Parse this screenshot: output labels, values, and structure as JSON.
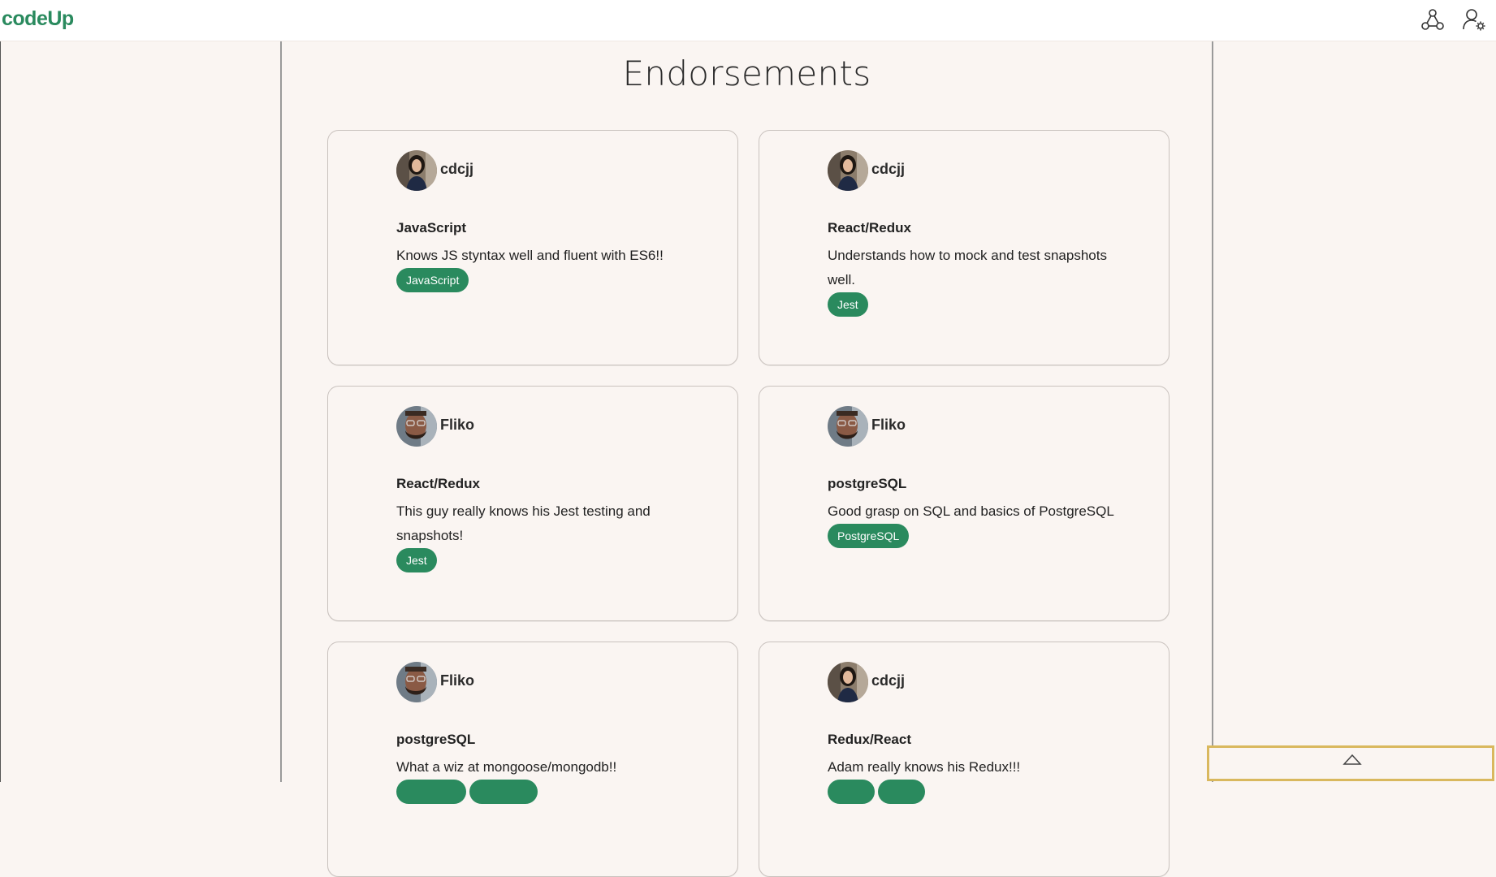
{
  "app": {
    "brand": "codeUp"
  },
  "header": {
    "icons": [
      "network-icon",
      "user-settings-icon"
    ]
  },
  "page": {
    "title": "Endorsements"
  },
  "colors": {
    "brand": "#2a8a5e",
    "tag_bg": "#2a8a5e",
    "background": "#faf5f2",
    "scroll_border": "#d9b85e"
  },
  "endorsements": [
    {
      "user": "cdcjj",
      "avatar": "woman-avatar",
      "skill": "JavaScript",
      "comment": "Knows JS styntax well and fluent with ES6!!",
      "tags": [
        "JavaScript"
      ]
    },
    {
      "user": "cdcjj",
      "avatar": "woman-avatar",
      "skill": "React/Redux",
      "comment": "Understands how to mock and test snapshots well.",
      "tags": [
        "Jest"
      ]
    },
    {
      "user": "Fliko",
      "avatar": "man-avatar",
      "skill": "React/Redux",
      "comment": "This guy really knows his Jest testing and snapshots!",
      "tags": [
        "Jest"
      ]
    },
    {
      "user": "Fliko",
      "avatar": "man-avatar",
      "skill": "postgreSQL",
      "comment": "Good grasp on SQL and basics of PostgreSQL",
      "tags": [
        "PostgreSQL"
      ]
    },
    {
      "user": "Fliko",
      "avatar": "man-avatar",
      "skill": "postgreSQL",
      "comment": "What a wiz at mongoose/mongodb!!",
      "tags": [
        "",
        ""
      ]
    },
    {
      "user": "cdcjj",
      "avatar": "woman-avatar",
      "skill": "Redux/React",
      "comment": "Adam really knows his Redux!!!",
      "tags": [
        "",
        ""
      ]
    }
  ]
}
